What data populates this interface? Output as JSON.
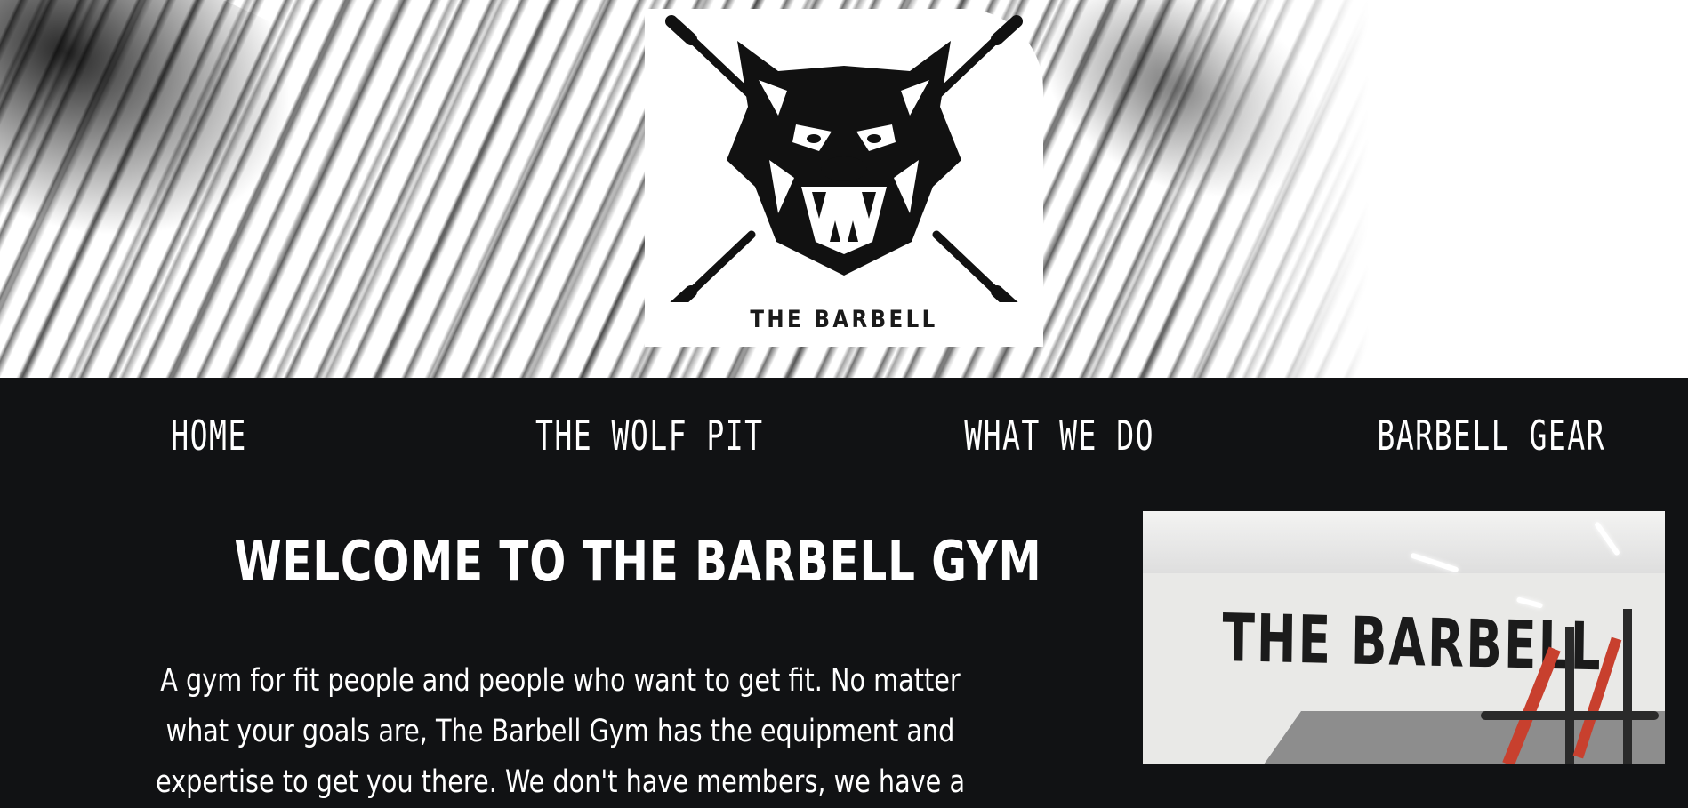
{
  "logo": {
    "text": "THE BARBELL"
  },
  "nav": {
    "items": [
      {
        "label": "HOME"
      },
      {
        "label": "THE WOLF PIT"
      },
      {
        "label": "WHAT WE DO"
      },
      {
        "label": "BARBELL GEAR"
      }
    ]
  },
  "main": {
    "title": "WELCOME TO THE BARBELL GYM",
    "intro": "A gym for fit people and people who want to get fit. No matter what your goals are, The Barbell Gym has the equipment and expertise to get you there. We don't have members, we have a"
  },
  "photo": {
    "wall_text": "THE BARBELL"
  },
  "colors": {
    "background": "#111214",
    "text": "#ffffff",
    "hero": "#ffffff"
  }
}
